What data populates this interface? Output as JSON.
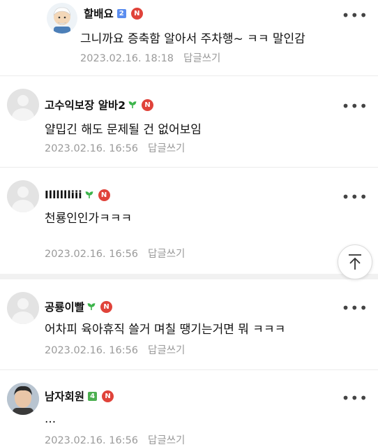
{
  "comments": [
    {
      "nickname": "할배요",
      "grade": "2",
      "grade_color": "#5b8def",
      "text": "그니까요 증축함 알아서 주차행~ ㅋㅋ 말인감",
      "time": "2023.02.16. 18:18",
      "reply": "답글쓰기",
      "more": "•••"
    },
    {
      "nickname": "고수익보장 알바2",
      "text": "얄밉긴 해도 문제될 건 없어보임",
      "time": "2023.02.16. 16:56",
      "reply": "답글쓰기",
      "more": "•••"
    },
    {
      "nickname": "Illlllliii",
      "text": "천룡인인가ㅋㅋㅋ",
      "time": "2023.02.16. 16:56",
      "reply": "답글쓰기",
      "more": "•••"
    },
    {
      "nickname": "공룡이빨",
      "text": "어차피 육아휴직 쓸거 며칠 땡기는거면 뭐 ㅋㅋㅋ",
      "time": "2023.02.16. 16:56",
      "reply": "답글쓰기",
      "more": "•••"
    },
    {
      "nickname": "남자회원",
      "grade": "4",
      "grade_color": "#4caf50",
      "text": "...",
      "time": "2023.02.16. 16:56",
      "reply": "답글쓰기",
      "more": "•••"
    }
  ],
  "badge_letter": "N",
  "colors": {
    "n_badge": "#e0433a",
    "sprout": "#3cb44b",
    "meta": "#9a9a9a"
  },
  "icons": {
    "scroll_top": "arrow-up-to-line-icon",
    "more": "more-dots-icon",
    "sprout": "sprout-icon",
    "new": "n-badge-icon"
  }
}
